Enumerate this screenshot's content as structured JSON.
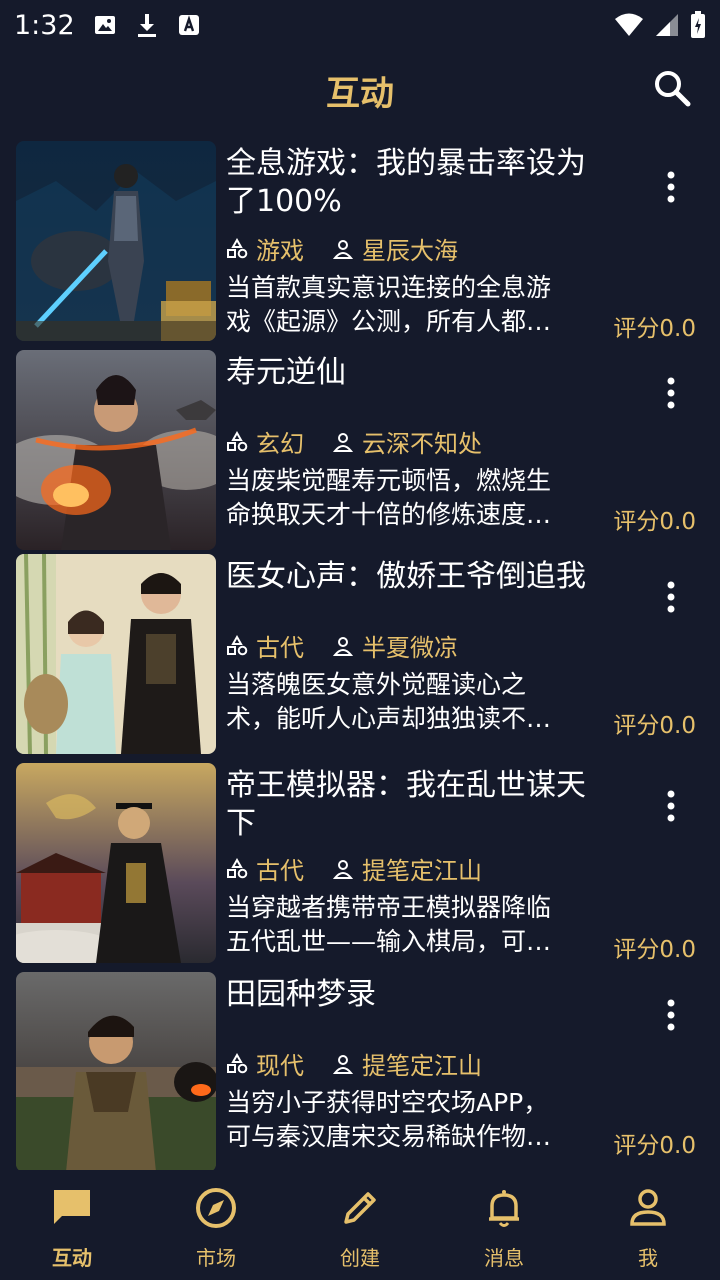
{
  "status": {
    "time": "1:32"
  },
  "header": {
    "title": "互动"
  },
  "stories": [
    {
      "title_line1": "全息游戏：我的暴击率设为",
      "title_line2": "了100%",
      "category": "游戏",
      "author": "星辰大海",
      "desc_line1": "当首款真实意识连接的全息游",
      "desc_line2": "戏《起源》公测，所有人都…",
      "score": "评分0.0"
    },
    {
      "title_line1": "寿元逆仙",
      "title_line2": "",
      "category": "玄幻",
      "author": "云深不知处",
      "desc_line1": "当废柴觉醒寿元顿悟，燃烧生",
      "desc_line2": "命换取天才十倍的修炼速度…",
      "score": "评分0.0"
    },
    {
      "title_line1": "医女心声：傲娇王爷倒追我",
      "title_line2": "",
      "category": "古代",
      "author": "半夏微凉",
      "desc_line1": "当落魄医女意外觉醒读心之",
      "desc_line2": "术，能听人心声却独独读不…",
      "score": "评分0.0"
    },
    {
      "title_line1": "帝王模拟器：我在乱世谋天",
      "title_line2": "下",
      "category": "古代",
      "author": "提笔定江山",
      "desc_line1": "当穿越者携带帝王模拟器降临",
      "desc_line2": "五代乱世——输入棋局，可…",
      "score": "评分0.0"
    },
    {
      "title_line1": "田园种梦录",
      "title_line2": "",
      "category": "现代",
      "author": "提笔定江山",
      "desc_line1": "当穷小子获得时空农场APP，",
      "desc_line2": "可与秦汉唐宋交易稀缺作物…",
      "score": "评分0.0"
    }
  ],
  "nav": [
    {
      "label": "互动",
      "icon": "chat-icon",
      "active": true
    },
    {
      "label": "市场",
      "icon": "compass-icon"
    },
    {
      "label": "创建",
      "icon": "pencil-icon"
    },
    {
      "label": "消息",
      "icon": "bell-icon"
    },
    {
      "label": "我",
      "icon": "person-icon"
    }
  ],
  "colors": {
    "background": "#151a2b",
    "accent": "#e6c06b",
    "text": "#ffffff"
  }
}
